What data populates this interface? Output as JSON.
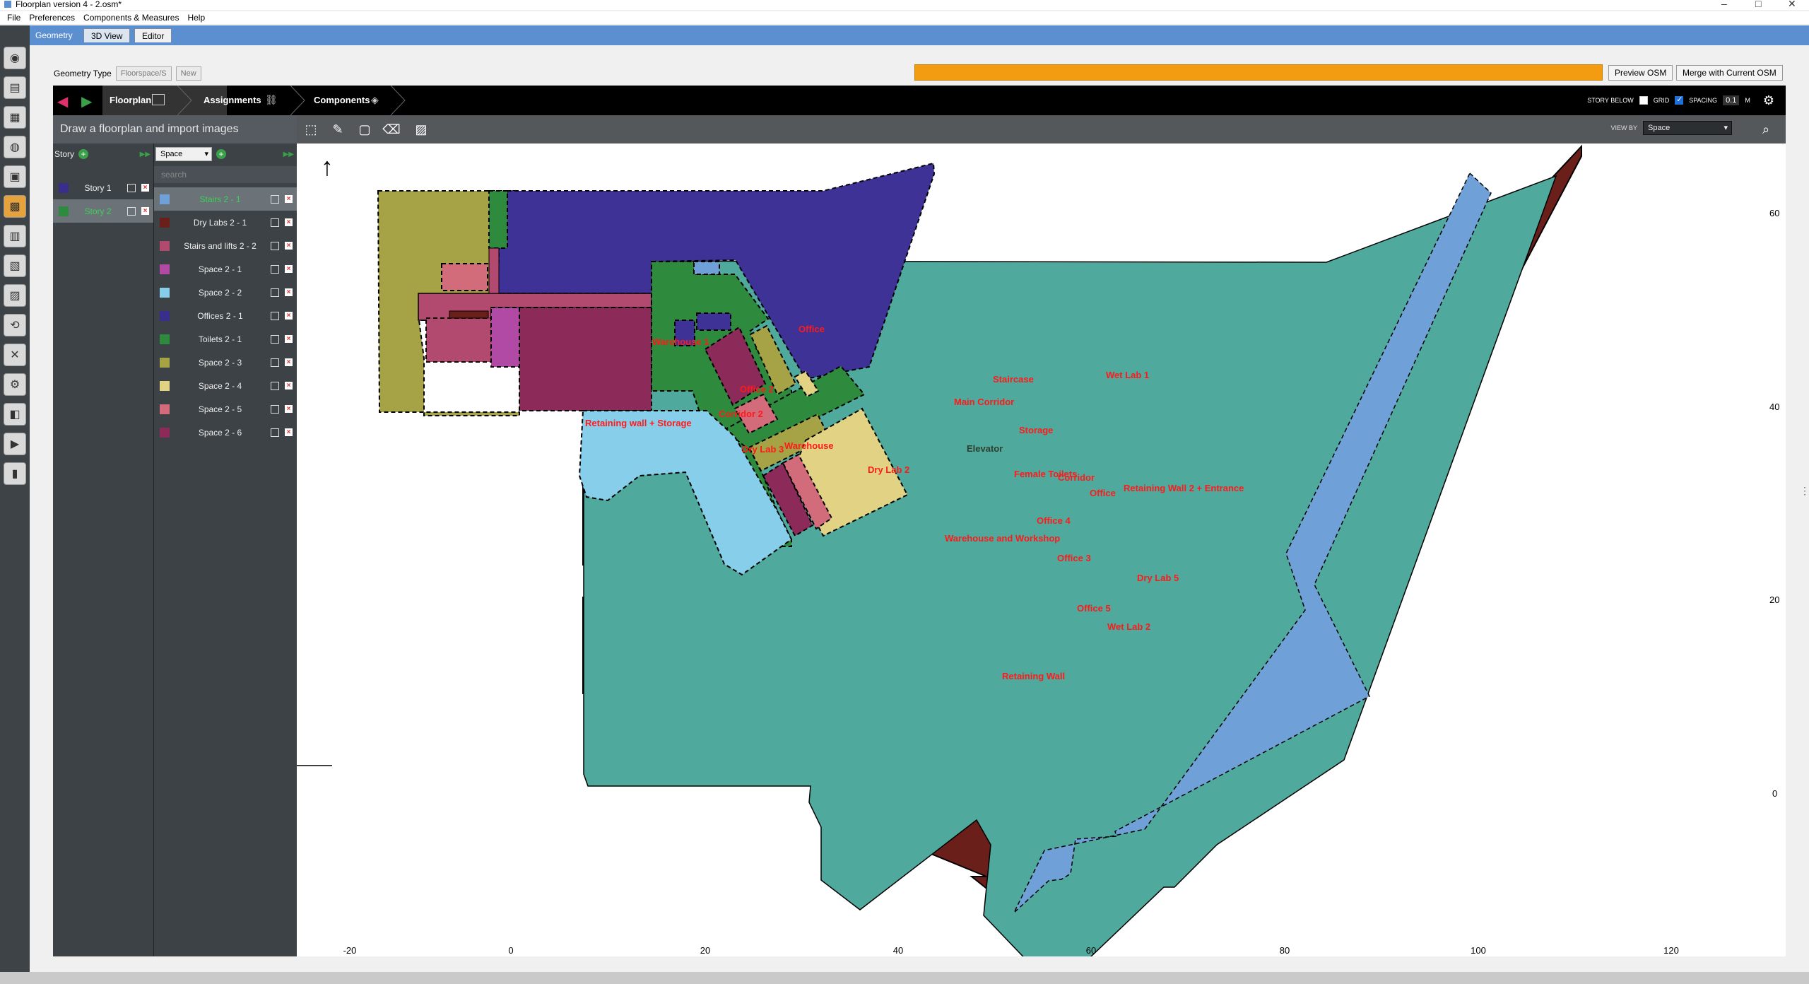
{
  "window": {
    "title": "Floorplan version 4 - 2.osm*"
  },
  "menu": [
    "File",
    "Preferences",
    "Components & Measures",
    "Help"
  ],
  "geometry_tab": {
    "label": "Geometry",
    "tabs": [
      "3D View",
      "Editor"
    ]
  },
  "geometry_type": {
    "label": "Geometry Type",
    "value": "Floorspace/S",
    "new_label": "New"
  },
  "actions": {
    "preview": "Preview OSM",
    "merge": "Merge with Current OSM"
  },
  "nav": {
    "floorplan": "Floorplan",
    "assignments": "Assignments",
    "components": "Components",
    "story_below": "STORY BELOW",
    "grid": "GRID",
    "spacing": "SPACING",
    "spacing_value": "0.1",
    "spacing_unit": "M",
    "view_by": "VIEW BY",
    "view_by_value": "Space"
  },
  "left_panel": {
    "instructions": "Draw a floorplan and import images",
    "story_header": "Story",
    "space_select": "Space",
    "search_placeholder": "search",
    "stories": [
      {
        "name": "Story 1",
        "color": "#3a2e8c"
      },
      {
        "name": "Story 2",
        "color": "#2d8a3e"
      }
    ],
    "spaces": [
      {
        "name": "Stairs 2 - 1",
        "color": "#6fa0d8"
      },
      {
        "name": "Dry Labs 2 - 1",
        "color": "#6b1f1a"
      },
      {
        "name": "Stairs and lifts 2 - 2",
        "color": "#b24a70"
      },
      {
        "name": "Space 2 - 1",
        "color": "#b04aa5"
      },
      {
        "name": "Space 2 - 2",
        "color": "#87ceeb"
      },
      {
        "name": "Offices 2 - 1",
        "color": "#3a2e8c"
      },
      {
        "name": "Toilets 2 - 1",
        "color": "#2e8b3e"
      },
      {
        "name": "Space 2 - 3",
        "color": "#a5a345"
      },
      {
        "name": "Space 2 - 4",
        "color": "#e2d283"
      },
      {
        "name": "Space 2 - 5",
        "color": "#d26b7a"
      },
      {
        "name": "Space 2 - 6",
        "color": "#8c2a5a"
      }
    ]
  },
  "plan_labels": [
    "Warehouse 1",
    "Office",
    "Office 2",
    "Corridor 2",
    "Dry Lab 3",
    "Warehouse",
    "Dry Lab 2",
    "Retaining wall + Storage",
    "Main Corridor",
    "Staircase",
    "Wet Lab 1",
    "Elevator",
    "Storage",
    "Female Toilets",
    "Corridor",
    "Office",
    "Retaining Wall 2 + Entrance",
    "Office 4",
    "Warehouse and Workshop",
    "Office 3",
    "Dry Lab 5",
    "Office 5",
    "Wet Lab 2",
    "Retaining Wall"
  ],
  "axes": {
    "x_ticks": [
      "-20",
      "0",
      "20",
      "40",
      "60",
      "80",
      "100",
      "120"
    ],
    "y_ticks": [
      "60",
      "40",
      "20",
      "0"
    ]
  }
}
